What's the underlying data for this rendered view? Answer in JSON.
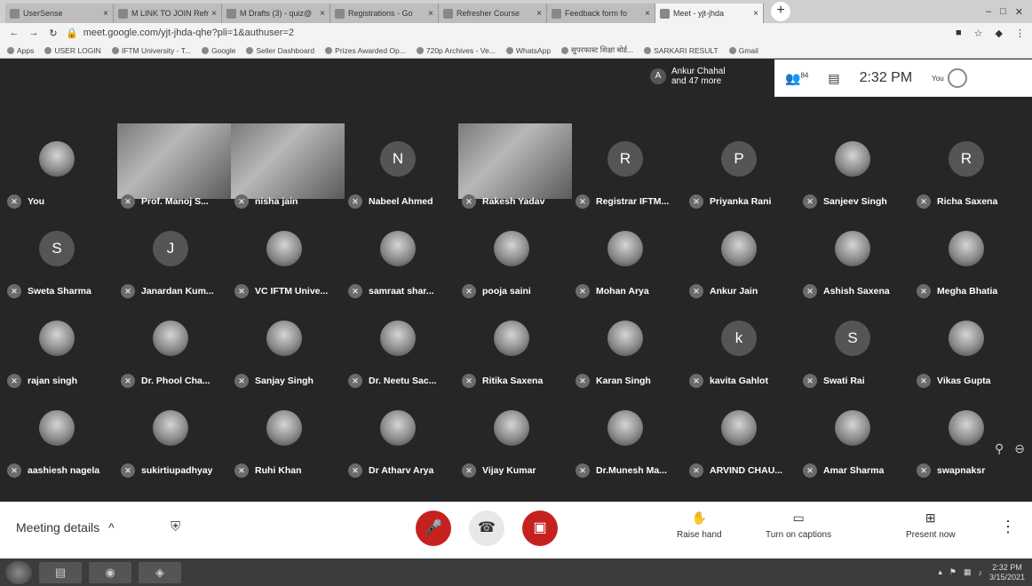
{
  "browser": {
    "tabs": [
      {
        "label": "UserSense"
      },
      {
        "label": "M LINK TO JOIN Refr"
      },
      {
        "label": "M Drafts (3) - quiz@"
      },
      {
        "label": "Registrations - Go"
      },
      {
        "label": "Refresher Course"
      },
      {
        "label": "Feedback form fo"
      },
      {
        "label": "Meet - yjt-jhda",
        "active": true
      }
    ],
    "url": "meet.google.com/yjt-jhda-qhe?pli=1&authuser=2",
    "bookmarks": [
      "Apps",
      "USER LOGIN",
      "IFTM University - T...",
      "Google",
      "Seller Dashboard",
      "Prizes Awarded Op...",
      "720p Archives - Ve...",
      "WhatsApp",
      "सुपरफास्ट शिक्षा बोर्ड...",
      "SARKARI RESULT",
      "Gmail"
    ]
  },
  "meet": {
    "people_chip": {
      "avatar": "A",
      "line1": "Ankur Chahal",
      "line2": "and 47 more"
    },
    "participant_count": "84",
    "time": "2:32 PM",
    "you_label": "You",
    "participants": [
      {
        "name": "You",
        "kind": "photo"
      },
      {
        "name": "Prof. Manoj S...",
        "kind": "video"
      },
      {
        "name": "nisha jain",
        "kind": "video"
      },
      {
        "name": "Nabeel Ahmed",
        "kind": "letter",
        "letter": "N"
      },
      {
        "name": "Rakesh Yadav",
        "kind": "video"
      },
      {
        "name": "Registrar IFTM...",
        "kind": "letter",
        "letter": "R"
      },
      {
        "name": "Priyanka Rani",
        "kind": "letter",
        "letter": "P"
      },
      {
        "name": "Sanjeev Singh",
        "kind": "photo"
      },
      {
        "name": "Richa Saxena",
        "kind": "letter",
        "letter": "R"
      },
      {
        "name": "Sweta Sharma",
        "kind": "letter",
        "letter": "S"
      },
      {
        "name": "Janardan Kum...",
        "kind": "letter",
        "letter": "J"
      },
      {
        "name": "VC IFTM Unive...",
        "kind": "photo"
      },
      {
        "name": "samraat shar...",
        "kind": "photo"
      },
      {
        "name": "pooja saini",
        "kind": "photo"
      },
      {
        "name": "Mohan Arya",
        "kind": "photo"
      },
      {
        "name": "Ankur Jain",
        "kind": "photo"
      },
      {
        "name": "Ashish Saxena",
        "kind": "photo"
      },
      {
        "name": "Megha Bhatia",
        "kind": "photo"
      },
      {
        "name": "rajan singh",
        "kind": "photo"
      },
      {
        "name": "Dr. Phool Cha...",
        "kind": "photo"
      },
      {
        "name": "Sanjay Singh",
        "kind": "photo"
      },
      {
        "name": "Dr. Neetu Sac...",
        "kind": "photo"
      },
      {
        "name": "Ritika Saxena",
        "kind": "photo"
      },
      {
        "name": "Karan Singh",
        "kind": "photo"
      },
      {
        "name": "kavita Gahlot",
        "kind": "letter",
        "letter": "k"
      },
      {
        "name": "Swati Rai",
        "kind": "letter",
        "letter": "S"
      },
      {
        "name": "Vikas Gupta",
        "kind": "photo"
      },
      {
        "name": "aashiesh nagela",
        "kind": "photo"
      },
      {
        "name": "sukirtiupadhyay",
        "kind": "photo"
      },
      {
        "name": "Ruhi Khan",
        "kind": "photo"
      },
      {
        "name": "Dr Atharv Arya",
        "kind": "photo"
      },
      {
        "name": "Vijay Kumar",
        "kind": "photo"
      },
      {
        "name": "Dr.Munesh Ma...",
        "kind": "photo"
      },
      {
        "name": "ARVIND CHAU...",
        "kind": "photo"
      },
      {
        "name": "Amar Sharma",
        "kind": "photo"
      },
      {
        "name": "swapnaksr",
        "kind": "photo"
      }
    ]
  },
  "bottombar": {
    "meeting_details": "Meeting details",
    "raise_hand": "Raise hand",
    "captions": "Turn on captions",
    "present": "Present now"
  },
  "taskbar": {
    "time": "2:32 PM",
    "date": "3/15/2021"
  },
  "colors": {
    "end_call": "#c5221f",
    "mute_red": "#c5221f"
  }
}
